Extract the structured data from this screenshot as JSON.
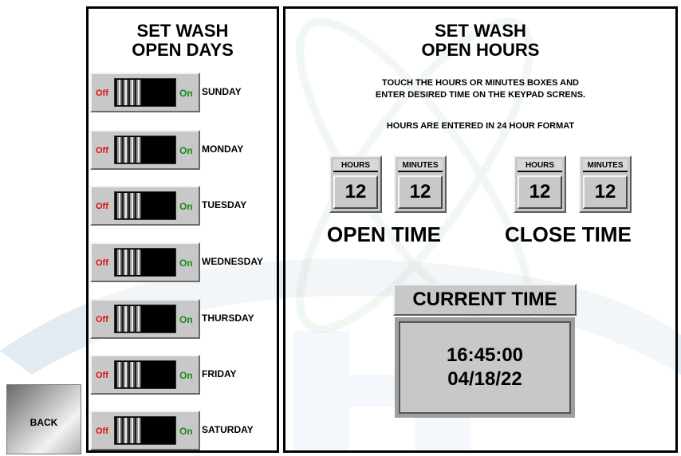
{
  "open_days": {
    "title_line1": "SET WASH",
    "title_line2": "OPEN DAYS",
    "off_label": "Off",
    "on_label": "On",
    "days": [
      {
        "label": "SUNDAY",
        "state": "off"
      },
      {
        "label": "MONDAY",
        "state": "off"
      },
      {
        "label": "TUESDAY",
        "state": "off"
      },
      {
        "label": "WEDNESDAY",
        "state": "off"
      },
      {
        "label": "THURSDAY",
        "state": "off"
      },
      {
        "label": "FRIDAY",
        "state": "off"
      },
      {
        "label": "SATURDAY",
        "state": "off"
      }
    ]
  },
  "open_hours": {
    "title_line1": "SET WASH",
    "title_line2": "OPEN HOURS",
    "instructions_line1": "TOUCH THE HOURS OR MINUTES BOXES AND",
    "instructions_line2": "ENTER DESIRED TIME ON THE KEYPAD SCRENS.",
    "format_note": "HOURS ARE ENTERED IN 24 HOUR FORMAT",
    "hours_label": "HOURS",
    "minutes_label": "MINUTES",
    "open_time": {
      "label": "OPEN TIME",
      "hours": "12",
      "minutes": "12"
    },
    "close_time": {
      "label": "CLOSE TIME",
      "hours": "12",
      "minutes": "12"
    }
  },
  "current_time": {
    "title": "CURRENT TIME",
    "time": "16:45:00",
    "date": "04/18/22"
  },
  "back_button": {
    "label": "BACK"
  },
  "colors": {
    "off": "#e01010",
    "on": "#1a8a1a",
    "panel_gray": "#c8c8c8"
  }
}
